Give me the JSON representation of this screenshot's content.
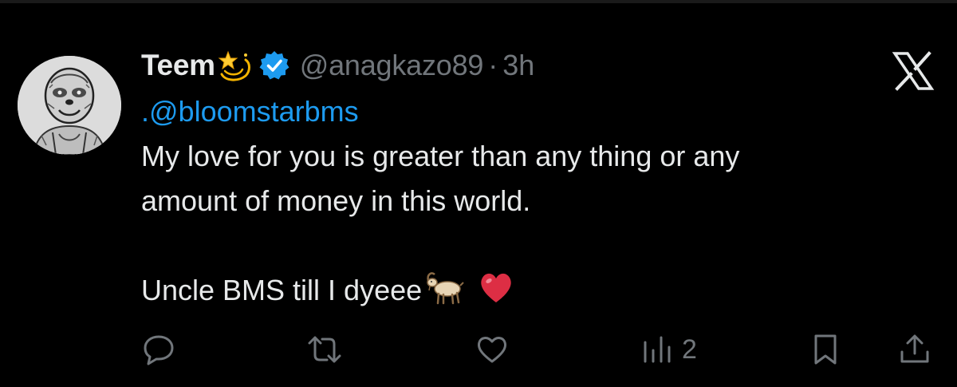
{
  "tweet": {
    "display_name": "Teem",
    "name_emoji": "dizzy-star-emoji",
    "verified": true,
    "handle": "@anagkazo89",
    "separator": "·",
    "time": "3h",
    "mention_prefix": ".",
    "mention": "@bloomstarbms",
    "body_lines": [
      "My love for you is greater than any thing or any",
      "amount of money in this world."
    ],
    "closing_text": "Uncle BMS till I dyeee",
    "closing_emojis": [
      "goat-emoji",
      "red-heart-emoji"
    ]
  },
  "actions": {
    "reply_icon": "reply-icon",
    "retweet_icon": "retweet-icon",
    "like_icon": "heart-icon",
    "views_icon": "views-bar-chart-icon",
    "views_count": "2",
    "bookmark_icon": "bookmark-icon",
    "share_icon": "share-icon"
  },
  "brand": {
    "logo": "x-logo-icon"
  },
  "colors": {
    "background": "#000000",
    "text_primary": "#e7e9ea",
    "text_secondary": "#71767b",
    "link": "#1d9bf0",
    "verified_badge": "#1d9bf0",
    "heart": "#dd2e44"
  }
}
